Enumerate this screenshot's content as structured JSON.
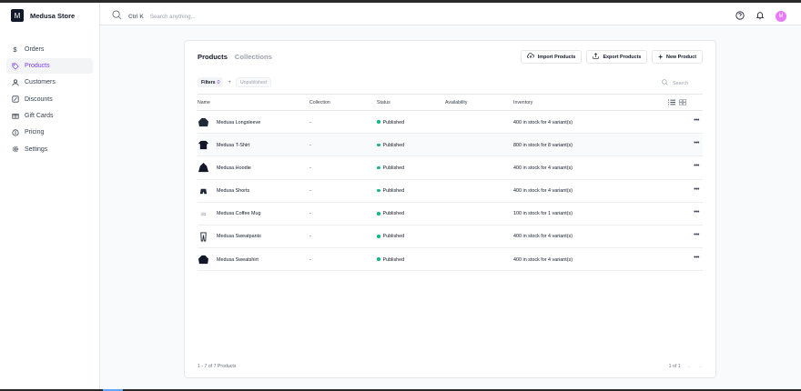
{
  "store": {
    "logo_letter": "M",
    "name": "Medusa Store"
  },
  "sidebar": {
    "items": [
      {
        "label": "Orders",
        "icon": "dollar-icon"
      },
      {
        "label": "Products",
        "icon": "tag-icon",
        "active": true
      },
      {
        "label": "Customers",
        "icon": "user-icon"
      },
      {
        "label": "Discounts",
        "icon": "receipt-icon"
      },
      {
        "label": "Gift Cards",
        "icon": "gift-icon"
      },
      {
        "label": "Pricing",
        "icon": "currency-icon"
      },
      {
        "label": "Settings",
        "icon": "gear-icon"
      }
    ]
  },
  "header": {
    "shortcut": "Ctrl K",
    "search_placeholder": "Search anything...",
    "avatar_letter": "M"
  },
  "card": {
    "tabs": [
      {
        "label": "Products",
        "active": true
      },
      {
        "label": "Collections",
        "active": false
      }
    ],
    "actions": {
      "import": "Import Products",
      "export": "Export Products",
      "new": "New Product"
    },
    "filters": {
      "label": "Filters",
      "count": "0",
      "chip": "Unpublished"
    },
    "search_placeholder": "Search"
  },
  "table": {
    "columns": [
      "Name",
      "Collection",
      "Status",
      "Availability",
      "Inventory"
    ],
    "rows": [
      {
        "name": "Medusa Longsleeve",
        "collection": "-",
        "status": "Published",
        "availability": "",
        "inventory": "400 in stock for 4 variant(s)",
        "thumb": "longsleeve"
      },
      {
        "name": "Medusa T-Shirt",
        "collection": "-",
        "status": "Published",
        "availability": "",
        "inventory": "800 in stock for 8 variant(s)",
        "thumb": "tshirt"
      },
      {
        "name": "Medusa Hoodie",
        "collection": "-",
        "status": "Published",
        "availability": "",
        "inventory": "400 in stock for 4 variant(s)",
        "thumb": "hoodie"
      },
      {
        "name": "Medusa Shorts",
        "collection": "-",
        "status": "Published",
        "availability": "",
        "inventory": "400 in stock for 4 variant(s)",
        "thumb": "shorts"
      },
      {
        "name": "Medusa Coffee Mug",
        "collection": "-",
        "status": "Published",
        "availability": "",
        "inventory": "100 in stock for 1 variant(s)",
        "thumb": "mug"
      },
      {
        "name": "Medusa Sweatpants",
        "collection": "-",
        "status": "Published",
        "availability": "",
        "inventory": "400 in stock for 4 variant(s)",
        "thumb": "sweatpants"
      },
      {
        "name": "Medusa Sweatshirt",
        "collection": "-",
        "status": "Published",
        "availability": "",
        "inventory": "400 in stock for 4 variant(s)",
        "thumb": "sweatshirt"
      }
    ]
  },
  "footer": {
    "count": "1 - 7 of 7 Products",
    "page": "1 of 1"
  },
  "colors": {
    "accent": "#7c3aed",
    "published": "#10b981"
  }
}
